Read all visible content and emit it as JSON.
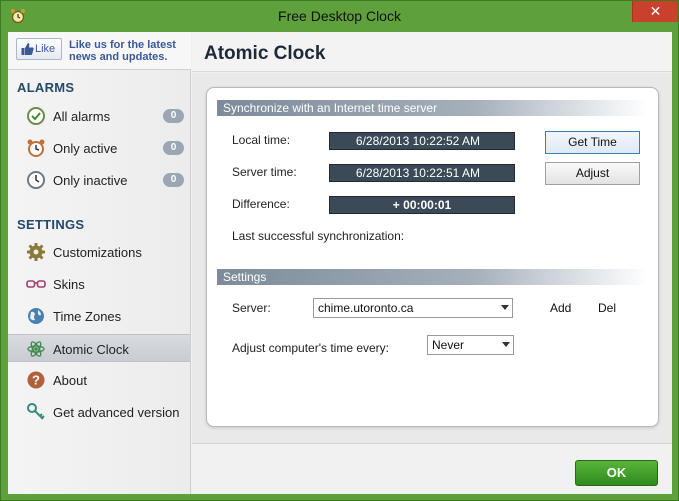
{
  "window": {
    "title": "Free Desktop Clock",
    "close_label": "✕"
  },
  "sidebar": {
    "like": {
      "button_label": "Like",
      "text": "Like us for the latest news and updates."
    },
    "alarms_title": "ALARMS",
    "alarms": [
      {
        "label": "All alarms",
        "count": "0",
        "icon": "check-clock-icon"
      },
      {
        "label": "Only active",
        "count": "0",
        "icon": "alarm-clock-icon"
      },
      {
        "label": "Only inactive",
        "count": "0",
        "icon": "clock-icon"
      }
    ],
    "settings_title": "SETTINGS",
    "settings": [
      {
        "label": "Customizations",
        "icon": "gear-icon"
      },
      {
        "label": "Skins",
        "icon": "glasses-icon"
      },
      {
        "label": "Time Zones",
        "icon": "globe-icon"
      },
      {
        "label": "Atomic Clock",
        "icon": "atom-icon",
        "selected": true
      },
      {
        "label": "About",
        "icon": "help-icon"
      },
      {
        "label": "Get advanced version",
        "icon": "key-icon"
      }
    ]
  },
  "main": {
    "title": "Atomic Clock",
    "sync": {
      "header": "Synchronize with an Internet time server",
      "local_label": "Local time:",
      "local_value": "6/28/2013 10:22:52 AM",
      "server_label": "Server time:",
      "server_value": "6/28/2013 10:22:51 AM",
      "diff_label": "Difference:",
      "diff_value": "+ 00:00:01",
      "last_sync_label": "Last successful synchronization:",
      "get_time_label": "Get Time",
      "adjust_label": "Adjust"
    },
    "settings": {
      "header": "Settings",
      "server_label": "Server:",
      "server_value": "chime.utoronto.ca",
      "add_label": "Add",
      "del_label": "Del",
      "adjust_every_label": "Adjust computer's time every:",
      "adjust_every_value": "Never"
    }
  },
  "footer": {
    "ok_label": "OK"
  },
  "colors": {
    "frame": "#5ea03c",
    "ok_button": "#3f9a28",
    "time_field": "#3c4a58",
    "section_title": "#234a6b"
  }
}
